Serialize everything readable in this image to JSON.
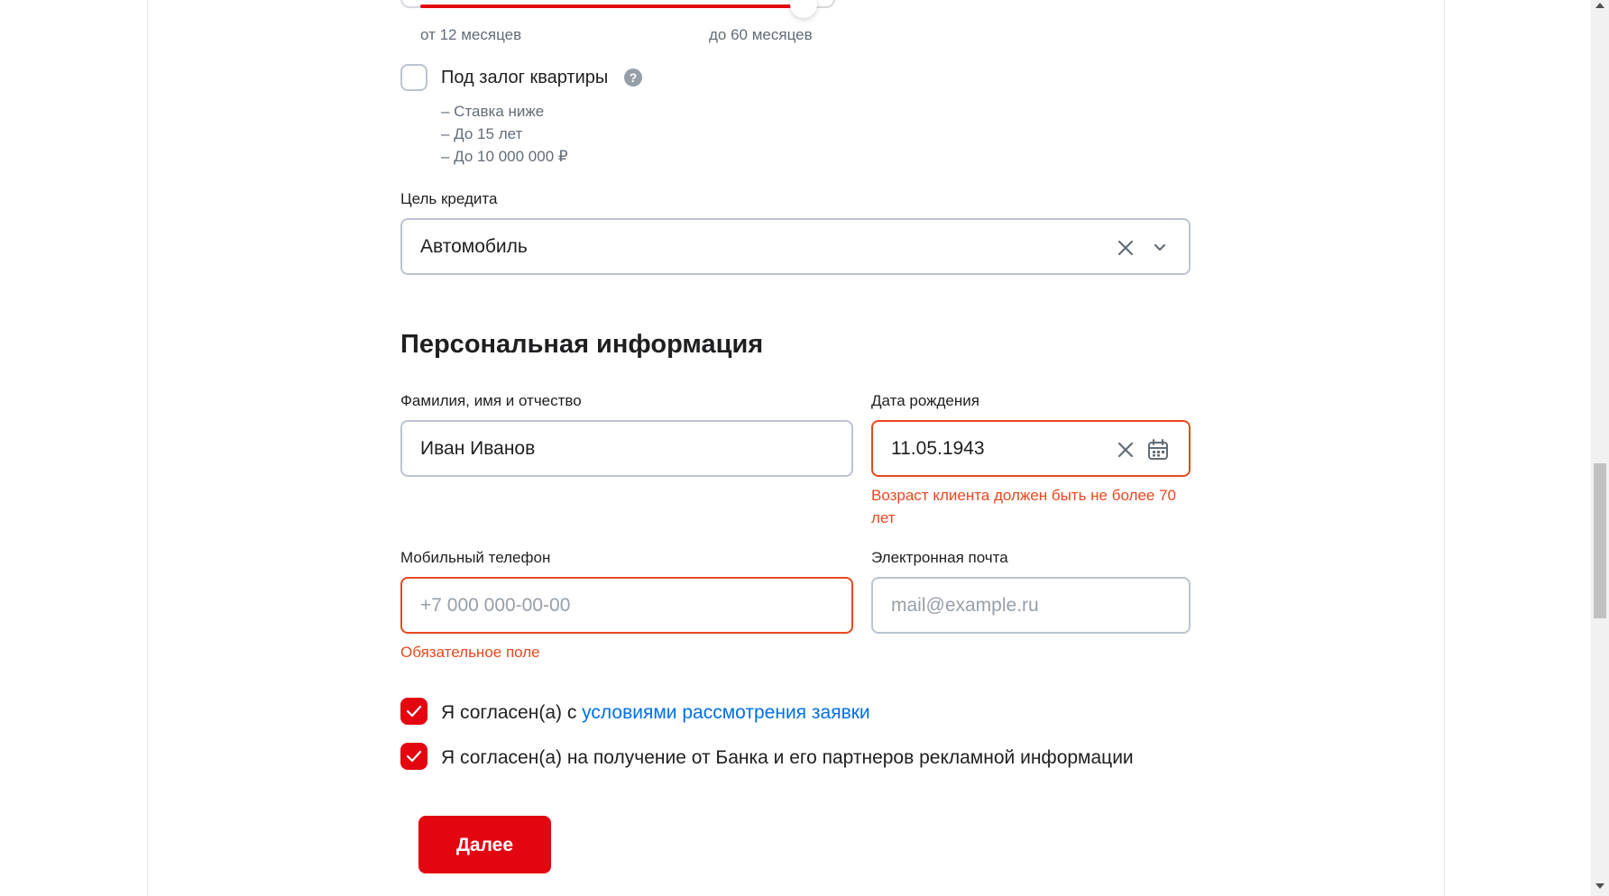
{
  "slider": {
    "min_label": "от 12 месяцев",
    "max_label": "до 60 месяцев",
    "fill_fraction": 0.82
  },
  "collateral": {
    "label": "Под залог квартиры",
    "help_icon": "question-circle-icon",
    "checked": false,
    "benefits": [
      "– Ставка ниже",
      "– До 15 лет",
      "– До 10 000 000 ₽"
    ]
  },
  "purpose": {
    "label": "Цель кредита",
    "value": "Автомобиль",
    "clear_icon": "close-icon",
    "dropdown_icon": "chevron-down-icon"
  },
  "personal": {
    "title": "Персональная информация",
    "full_name": {
      "label": "Фамилия, имя и отчество",
      "value": "Иван Иванов"
    },
    "birth_date": {
      "label": "Дата рождения",
      "value": "11.05.1943",
      "error": "Возраст клиента должен быть не более 70 лет",
      "clear_icon": "close-icon",
      "calendar_icon": "calendar-icon"
    },
    "phone": {
      "label": "Мобильный телефон",
      "placeholder": "+7 000 000-00-00",
      "error": "Обязательное поле"
    },
    "email": {
      "label": "Электронная почта",
      "placeholder": "mail@example.ru"
    }
  },
  "agreements": {
    "terms_prefix": "Я согласен(а) с ",
    "terms_link": "условиями рассмотрения заявки",
    "ads": "Я согласен(а) на получение от Банка и его партнеров рекламной информации"
  },
  "submit_label": "Далее",
  "colors": {
    "accent": "#e30611",
    "error": "#e8481f",
    "link": "#0070e5",
    "muted": "#626c77"
  }
}
